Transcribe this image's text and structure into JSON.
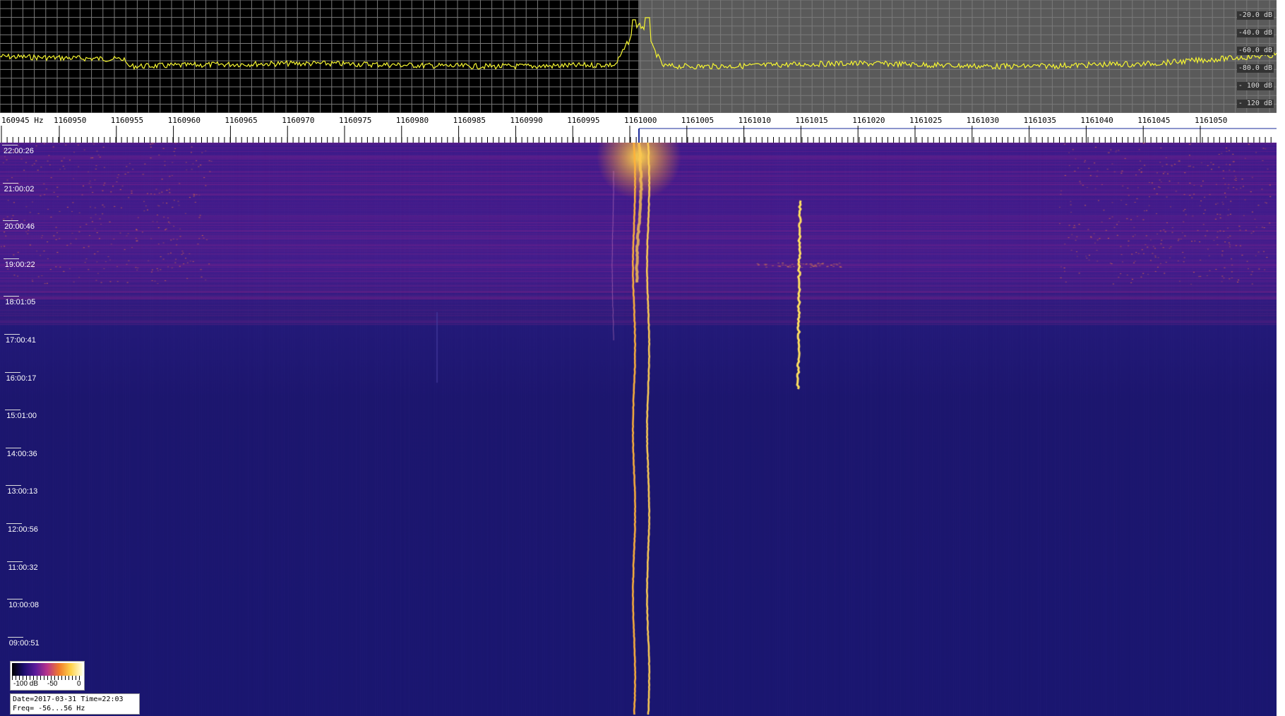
{
  "spectrum": {
    "db_labels": [
      "-20.0 dB",
      "-40.0 dB",
      "-60.0 dB",
      "-80.0 dB",
      "- 100 dB",
      "- 120 dB"
    ],
    "trace_color": "#f5f531",
    "left_panel_color": "#000000",
    "right_panel_color": "#5a5a5a"
  },
  "frequency_axis": {
    "labels": [
      "160945 Hz",
      "1160950",
      "1160955",
      "1160960",
      "1160965",
      "1160970",
      "1160975",
      "1160980",
      "1160985",
      "1160990",
      "1160995",
      "1161000",
      "1161005",
      "1161010",
      "1161015",
      "1161020",
      "1161025",
      "1161030",
      "1161035",
      "1161040",
      "1161045",
      "1161050"
    ]
  },
  "waterfall": {
    "time_labels": [
      "22:00:26",
      "21:00:02",
      "20:00:46",
      "19:00:22",
      "18:01:05",
      "17:00:41",
      "16:00:17",
      "15:01:00",
      "14:00:36",
      "13:00:13",
      "12:00:56",
      "11:00:32",
      "10:00:08",
      "09:00:51"
    ],
    "colors": {
      "low": "#1b1470",
      "mid": "#5a1a9a",
      "high": "#ffd24a"
    }
  },
  "colorbar": {
    "labels": [
      "-100 dB",
      "-50",
      "0"
    ]
  },
  "info": {
    "line1": "Date=2017-03-31 Time=22:03",
    "line2": "Freq= -56...56 Hz"
  }
}
